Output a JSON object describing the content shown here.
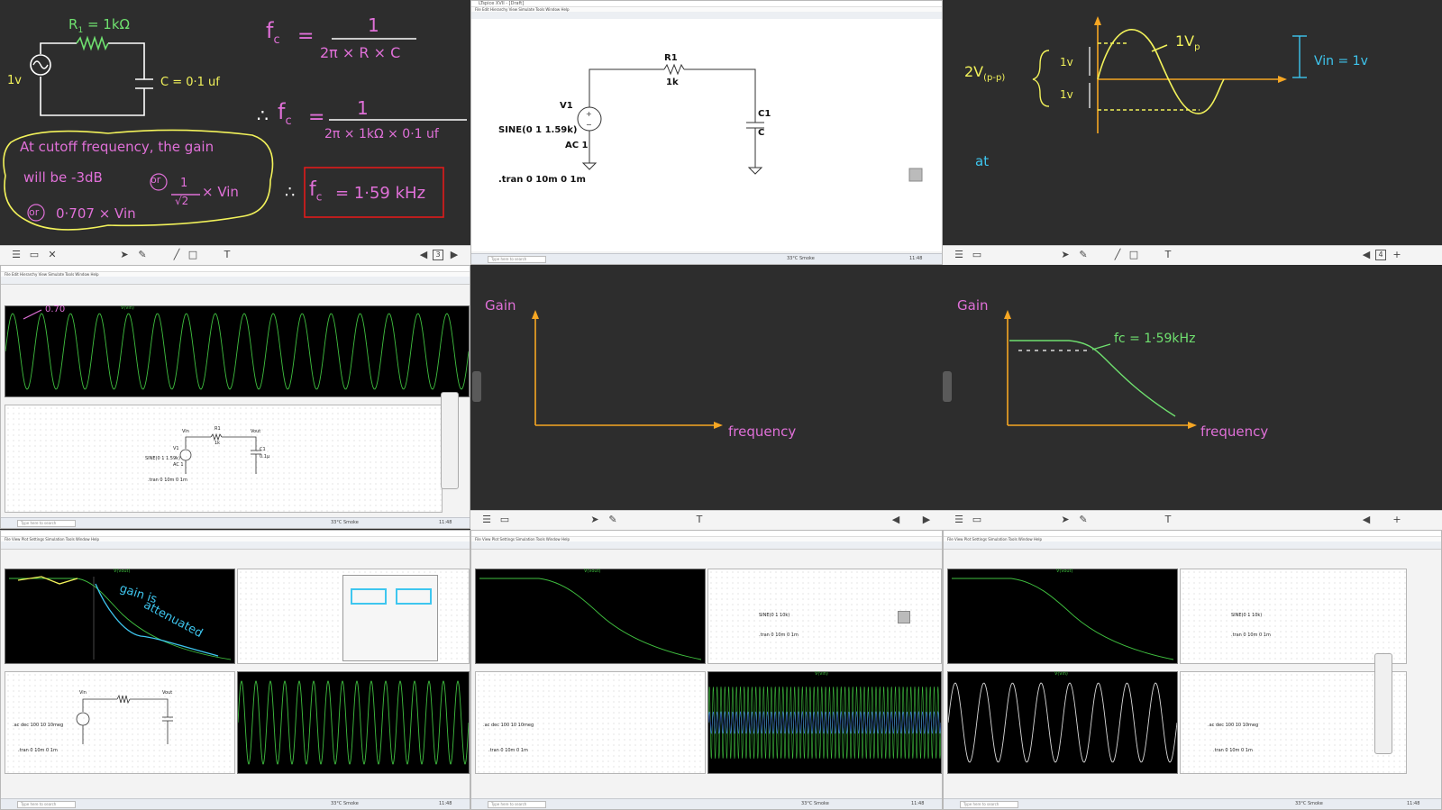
{
  "tile1": {
    "r_label": "R",
    "r_sub": "1",
    "r_value": "= 1kΩ",
    "source_label": "1v",
    "cap_label": "C = 0·1 uf",
    "fc": "f",
    "fc_sub": "c",
    "eq": "=",
    "numerator": "1",
    "denominator": "2π × R × C",
    "therefore": "∴",
    "denominator2": "2π × 1kΩ × 0·1 uf",
    "note_line1": "At cutoff frequency, the gain",
    "note_line2": "will be  -3dB",
    "note_or": "or",
    "note_frac_num": "1",
    "note_frac_den": "√2",
    "note_vin": "× Vin",
    "note_line3": "0·707 × Vin",
    "result": "= 1·59 kHz",
    "page_num": "3"
  },
  "tile2": {
    "title": "LTspice XVII - [Draft]",
    "r1": "R1",
    "r1_val": "1k",
    "v1": "V1",
    "sine": "SINE(0 1 1.59k)",
    "ac": "AC 1",
    "c1": "C1",
    "c1_val": "C",
    "tran": ".tran 0 10m 0 1m",
    "search": "Type here to search"
  },
  "tile3": {
    "vpp": "2V",
    "vpp_sub": "(p-p)",
    "one_v_top": "1v",
    "one_v_bottom": "1v",
    "vp": "1V",
    "vp_sub": "p",
    "vin": "Vin = 1v",
    "at": "at",
    "page_num": "4"
  },
  "tile4": {
    "annot": "0.70",
    "trace": "V(vin)",
    "vin": "Vin",
    "vout": "Vout",
    "r1": "R1",
    "r1_val": "1k",
    "v1": "V1",
    "sine": "SINE(0 1 1.59k)",
    "ac": "AC 1",
    "c1": "C1",
    "c1_val": "0.1µ",
    "tran": ".tran 0 10m 0 1m",
    "search": "Type here to search"
  },
  "tile5": {
    "ylabel": "Gain",
    "xlabel": "frequency"
  },
  "tile6": {
    "ylabel": "Gain",
    "xlabel": "frequency",
    "annot": "fc = 1·59kHz"
  },
  "tile7": {
    "annot1": "gain is",
    "annot2": "attenuated",
    "trace": "V(vout)",
    "ac_cmd": ".ac dec 100 10 10meg",
    "tran": ".tran 0 10m 0 1m",
    "vin": "Vin",
    "vout": "Vout",
    "search": "Type here to search"
  },
  "tile8": {
    "trace": "V(vout)",
    "sine": "SINE(0 1 10k)",
    "ac_cmd": ".ac dec 100 10 10meg",
    "tran": ".tran 0 10m 0 1m",
    "trace2": "V(vin)",
    "search": "Type here to search"
  },
  "tile9": {
    "trace": "V(vout)",
    "sine": "SINE(0 1 10k)",
    "ac_cmd": ".ac dec 100 10 10meg",
    "tran": ".tran 0 10m 0 1m",
    "trace2": "V(vin)",
    "search": "Type here to search"
  },
  "taskbar": {
    "weather": "33°C Smoke",
    "time": "11:48"
  },
  "colors": {
    "board": "#2d2d2d",
    "green": "#6fe06f",
    "pink": "#e070d8",
    "yellow": "#f2f25a",
    "orange": "#f5a623",
    "cyan": "#3ec6ef",
    "red": "#e01b1b",
    "trace_green": "#3fbf3f"
  }
}
